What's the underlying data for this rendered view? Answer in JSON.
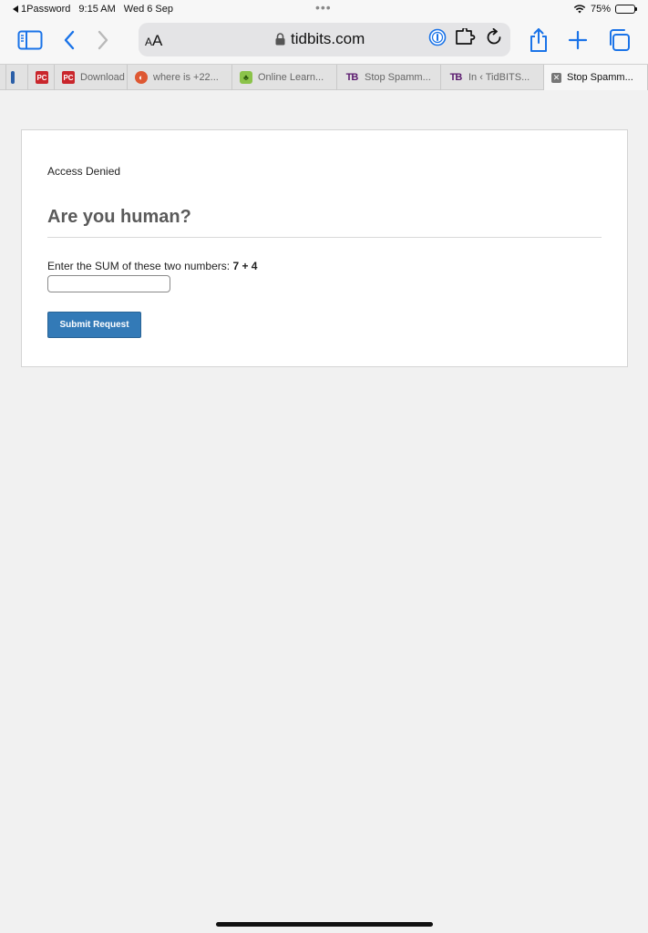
{
  "statusbar": {
    "back_app": "1Password",
    "time": "9:15 AM",
    "date": "Wed 6 Sep",
    "battery": "75%",
    "battery_level": 0.75
  },
  "toolbar": {
    "reader_label": "AA",
    "url": "tidbits.com"
  },
  "tabs": [
    {
      "label": "",
      "favicon": "pc"
    },
    {
      "label": "Download",
      "favicon": "pc"
    },
    {
      "label": "where is +22...",
      "favicon": "ddg"
    },
    {
      "label": "Online Learn...",
      "favicon": "ol"
    },
    {
      "label": "Stop Spamm...",
      "favicon": "tb"
    },
    {
      "label": "In ‹ TidBITS...",
      "favicon": "tb"
    },
    {
      "label": "Stop Spamm...",
      "favicon": "x",
      "active": true
    }
  ],
  "page": {
    "access_text": "Access Denied",
    "heading": "Are you human?",
    "question_prefix": "Enter the SUM of these two numbers: ",
    "question_numbers": "7 + 4",
    "answer_value": "",
    "submit_label": "Submit Request"
  },
  "colors": {
    "accent": "#1a73e8",
    "submit_bg": "#337ab7",
    "page_bg": "#f1f1f1"
  },
  "icons": {
    "sidebar": "sidebar-icon",
    "back": "chevron-left-icon",
    "forward": "chevron-right-icon",
    "lock": "lock-icon",
    "onepassword": "onepassword-icon",
    "extension": "puzzle-icon",
    "reload": "reload-icon",
    "share": "share-icon",
    "new_tab": "plus-icon",
    "tabs": "tabs-overview-icon"
  }
}
